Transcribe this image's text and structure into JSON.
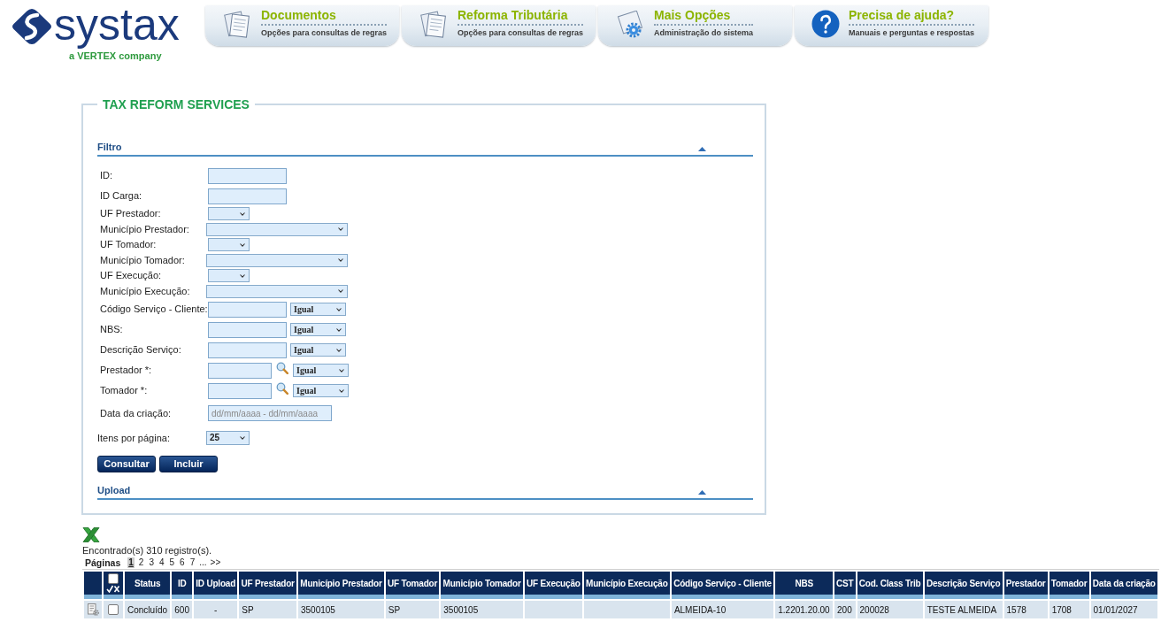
{
  "header": {
    "logo": {
      "wordmark": "systax",
      "tagline": "a VERTEX company"
    },
    "nav_tabs": [
      {
        "kind": "documents",
        "title": "Documentos",
        "subtitle": "Opções para consultas de regras"
      },
      {
        "kind": "documents",
        "title": "Reforma Tributária",
        "subtitle": "Opções para consultas de regras"
      },
      {
        "kind": "settings",
        "title": "Mais Opções",
        "subtitle": "Administração do sistema"
      },
      {
        "kind": "help",
        "title": "Precisa de ajuda?",
        "subtitle": "Manuais e perguntas e respostas"
      }
    ]
  },
  "panel": {
    "title": "TAX REFORM SERVICES",
    "filter_section": {
      "title": "Filtro"
    },
    "fields": [
      {
        "kind": "text",
        "label": "ID:"
      },
      {
        "kind": "text",
        "label": "ID Carga:"
      },
      {
        "kind": "select_short",
        "label": "UF Prestador:"
      },
      {
        "kind": "select_long",
        "label": "Município Prestador:"
      },
      {
        "kind": "select_short",
        "label": "UF Tomador:"
      },
      {
        "kind": "select_long",
        "label": "Município Tomador:"
      },
      {
        "kind": "select_short",
        "label": "UF Execução:"
      },
      {
        "kind": "select_long",
        "label": "Município Execução:"
      },
      {
        "kind": "text_match",
        "label": "Código Serviço - Cliente:",
        "match": "Igual"
      },
      {
        "kind": "text_match",
        "label": "NBS:",
        "match": "Igual"
      },
      {
        "kind": "text_match",
        "label": "Descrição Serviço:",
        "match": "Igual"
      },
      {
        "kind": "lookup",
        "label": "Prestador *:",
        "match": "Igual"
      },
      {
        "kind": "lookup",
        "label": "Tomador *:",
        "match": "Igual"
      },
      {
        "kind": "date_range",
        "label": "Data da criação:",
        "placeholder": "dd/mm/aaaa - dd/mm/aaaa"
      }
    ],
    "page_size": {
      "label": "Itens por página:",
      "value": "25"
    },
    "buttons": [
      {
        "label": "Consultar"
      },
      {
        "label": "Incluir"
      }
    ],
    "upload_section": {
      "title": "Upload"
    }
  },
  "results": {
    "summary": "Encontrado(s) 310 registro(s).",
    "pagination": {
      "label": "Páginas",
      "pages": [
        {
          "label": "1",
          "selected": true
        },
        {
          "label": "2",
          "selected": false
        },
        {
          "label": "3",
          "selected": false
        },
        {
          "label": "4",
          "selected": false
        },
        {
          "label": "5",
          "selected": false
        },
        {
          "label": "6",
          "selected": false
        },
        {
          "label": "7",
          "selected": false
        }
      ],
      "more": "...",
      "next": ">>"
    },
    "table": {
      "select_all_checked": false,
      "columns": [
        "Status",
        "ID",
        "ID Upload",
        "UF Prestador",
        "Município Prestador",
        "UF Tomador",
        "Município Tomador",
        "UF Execução",
        "Município Execução",
        "Código Serviço - Cliente",
        "NBS",
        "CST",
        "Cod. Class Trib",
        "Descrição Serviço",
        "Prestador",
        "Tomador",
        "Data da criação"
      ],
      "rows": [
        {
          "checked": false,
          "cells": [
            "Concluído",
            "600",
            "-",
            "SP",
            "3500105",
            "SP",
            "3500105",
            null,
            null,
            "ALMEIDA-10",
            "1.2201.20.00",
            "200",
            "200028",
            "TESTE ALMEIDA",
            "1578",
            "1708",
            "01/01/2027"
          ]
        }
      ]
    }
  }
}
